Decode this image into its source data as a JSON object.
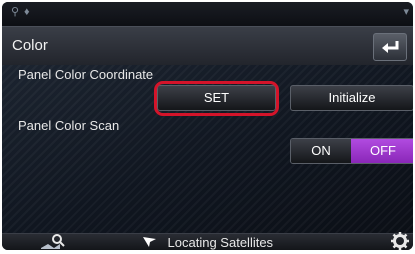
{
  "header": {
    "title": "Color"
  },
  "panel_color_coordinate": {
    "label": "Panel Color Coordinate",
    "set_label": "SET",
    "initialize_label": "Initialize"
  },
  "panel_color_scan": {
    "label": "Panel Color Scan",
    "on_label": "ON",
    "off_label": "OFF",
    "selected": "OFF"
  },
  "footer": {
    "status": "Locating Satellites"
  },
  "colors": {
    "highlight": "#d4142a",
    "toggle_active": "#a040d0"
  }
}
